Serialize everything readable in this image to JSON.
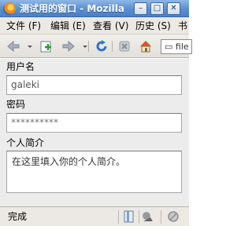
{
  "window": {
    "title": "测试用的窗口 - Mozilla",
    "minimize_glyph": "–",
    "maximize_glyph": "□",
    "close_glyph": "✕"
  },
  "menu": {
    "items": [
      {
        "label": "文件 (F)"
      },
      {
        "label": "编辑 (E)"
      },
      {
        "label": "查看 (V)"
      },
      {
        "label": "历史 (S)"
      },
      {
        "label": "书"
      }
    ]
  },
  "toolbar": {
    "icons": [
      "back-arrow-icon",
      "new-tab-icon",
      "forward-arrow-icon",
      "reload-icon",
      "stop-icon",
      "home-icon"
    ],
    "url_text": "file"
  },
  "form": {
    "username_label": "用户名",
    "username_value": "galeki",
    "password_label": "密码",
    "password_value": "**********",
    "bio_label": "个人简介",
    "bio_value": "在这里填入你的个人简介。"
  },
  "status": {
    "text": "完成",
    "icons": [
      "page-info-icon",
      "connection-icon",
      "block-icon"
    ]
  }
}
